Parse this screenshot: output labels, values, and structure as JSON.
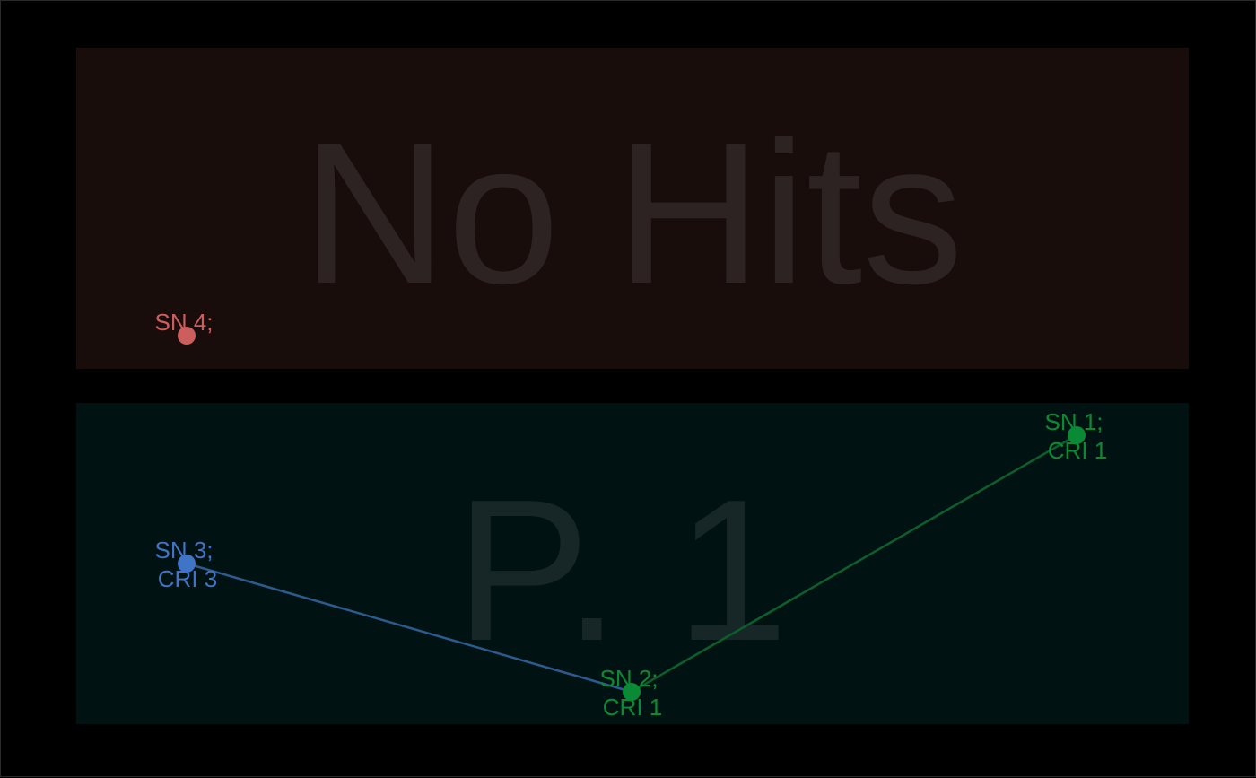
{
  "panels": [
    {
      "id": "no-hits",
      "watermark": "No Hits",
      "background": "#190d0c",
      "watermark_color": "#2e2323"
    },
    {
      "id": "p1",
      "watermark": "P. 1",
      "background": "#011212",
      "watermark_color": "#172626"
    }
  ],
  "nodes": [
    {
      "id": "sn4",
      "panel": "no-hits",
      "line1": "SN 4;",
      "line2": "",
      "color": "#cc5e5e"
    },
    {
      "id": "sn3",
      "panel": "p1",
      "line1": "SN 3;",
      "line2": "CRI 3",
      "color": "#3f74c6"
    },
    {
      "id": "sn2",
      "panel": "p1",
      "line1": "SN 2;",
      "line2": "CRI 1",
      "color": "#0b8a35"
    },
    {
      "id": "sn1",
      "panel": "p1",
      "line1": "SN 1;",
      "line2": "CRI 1",
      "color": "#0b8a35"
    }
  ],
  "edges": [
    {
      "from": "sn3",
      "to": "sn2",
      "color": "#2c5b8f"
    },
    {
      "from": "sn2",
      "to": "sn1",
      "color": "#0c5f2c"
    }
  ]
}
